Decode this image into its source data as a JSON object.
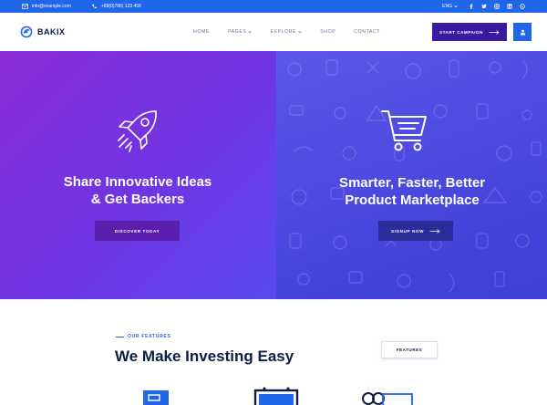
{
  "topbar": {
    "email": "info@example.com",
    "phone": "+88(0)786) 123 456",
    "language": "ENG",
    "social": [
      "facebook-icon",
      "twitter-icon",
      "instagram-icon",
      "linkedin-icon",
      "whatsapp-icon"
    ]
  },
  "header": {
    "logo_text": "BAKIX",
    "nav": [
      {
        "label": "HOME",
        "dropdown": false
      },
      {
        "label": "PAGES",
        "dropdown": true
      },
      {
        "label": "EXPLORE",
        "dropdown": true
      },
      {
        "label": "SHOP",
        "dropdown": false
      },
      {
        "label": "CONTACT",
        "dropdown": false
      }
    ],
    "cta_label": "START CAMPAIGN"
  },
  "hero": {
    "left": {
      "title_line1": "Share Innovative Ideas",
      "title_line2": "& Get Backers",
      "button_label": "DISCOVER TODAY",
      "icon": "rocket-icon"
    },
    "right": {
      "title_line1": "Smarter, Faster, Better",
      "title_line2": "Product Marketplace",
      "button_label": "SIGNUP NOW",
      "icon": "shopping-cart-icon"
    }
  },
  "features": {
    "subtitle": "OUR FEATURES",
    "title": "We Make Investing Easy",
    "button_label": "FEATURES"
  },
  "colors": {
    "accent_blue": "#1f66e8",
    "dark_purple": "#3b1aa3",
    "heading": "#0f1c43"
  }
}
